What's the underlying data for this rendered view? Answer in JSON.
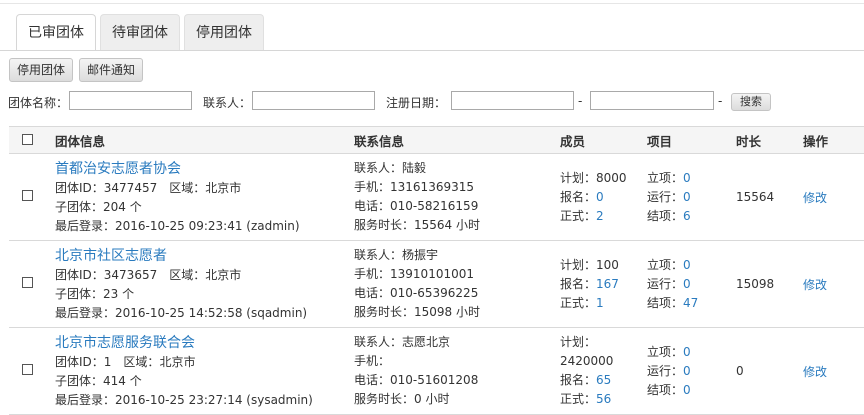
{
  "tabs": [
    "已审团体",
    "待审团体",
    "停用团体"
  ],
  "toolbar": {
    "disable_label": "停用团体",
    "email_label": "邮件通知"
  },
  "filters": {
    "name_label": "团体名称：",
    "contact_label": "联系人：",
    "date_label": "注册日期：",
    "separator": "-",
    "search_label": "搜索"
  },
  "columns": {
    "group": "团体信息",
    "contact": "联系信息",
    "members": "成员",
    "projects": "项目",
    "hours": "时长",
    "actions": "操作"
  },
  "rows": [
    {
      "name": "首都治安志愿者协会",
      "id_label": "团体ID：",
      "id": "3477457",
      "region_label": "区域：",
      "region": "北京市",
      "sub_label": "子团体：",
      "sub": "204 个",
      "login_label": "最后登录：",
      "login": "2016-10-25 09:23:41 (zadmin)",
      "contact_label": "联系人：",
      "contact": "陆毅",
      "mobile_label": "手机：",
      "mobile": "13161369315",
      "phone_label": "电话：",
      "phone": "010-58216159",
      "service_label": "服务时长：",
      "service": "15564 小时",
      "plan_label": "计划：",
      "plan": "8000",
      "signup_label": "报名：",
      "signup": "0",
      "formal_label": "正式：",
      "formal": "2",
      "proj_open_label": "立项：",
      "proj_open": "0",
      "proj_run_label": "运行：",
      "proj_run": "0",
      "proj_done_label": "结项：",
      "proj_done": "6",
      "hours": "15564",
      "edit": "修改"
    },
    {
      "name": "北京市社区志愿者",
      "id_label": "团体ID：",
      "id": "3473657",
      "region_label": "区域：",
      "region": "北京市",
      "sub_label": "子团体：",
      "sub": "23 个",
      "login_label": "最后登录：",
      "login": "2016-10-25 14:52:58 (sqadmin)",
      "contact_label": "联系人：",
      "contact": "杨振宇",
      "mobile_label": "手机：",
      "mobile": "13910101001",
      "phone_label": "电话：",
      "phone": "010-65396225",
      "service_label": "服务时长：",
      "service": "15098 小时",
      "plan_label": "计划：",
      "plan": "100",
      "signup_label": "报名：",
      "signup": "167",
      "formal_label": "正式：",
      "formal": "1",
      "proj_open_label": "立项：",
      "proj_open": "0",
      "proj_run_label": "运行：",
      "proj_run": "0",
      "proj_done_label": "结项：",
      "proj_done": "47",
      "hours": "15098",
      "edit": "修改"
    },
    {
      "name": "北京市志愿服务联合会",
      "id_label": "团体ID：",
      "id": "1",
      "region_label": "区域：",
      "region": "北京市",
      "sub_label": "子团体：",
      "sub": "414 个",
      "login_label": "最后登录：",
      "login": "2016-10-25 23:27:14 (sysadmin)",
      "contact_label": "联系人：",
      "contact": "志愿北京",
      "mobile_label": "手机：",
      "mobile": "",
      "phone_label": "电话：",
      "phone": "010-51601208",
      "service_label": "服务时长：",
      "service": "0 小时",
      "plan_label": "计划：",
      "plan": "2420000",
      "signup_label": "报名：",
      "signup": "65",
      "formal_label": "正式：",
      "formal": "56",
      "proj_open_label": "立项：",
      "proj_open": "0",
      "proj_run_label": "运行：",
      "proj_run": "0",
      "proj_done_label": "结项：",
      "proj_done": "0",
      "hours": "0",
      "edit": "修改"
    }
  ]
}
